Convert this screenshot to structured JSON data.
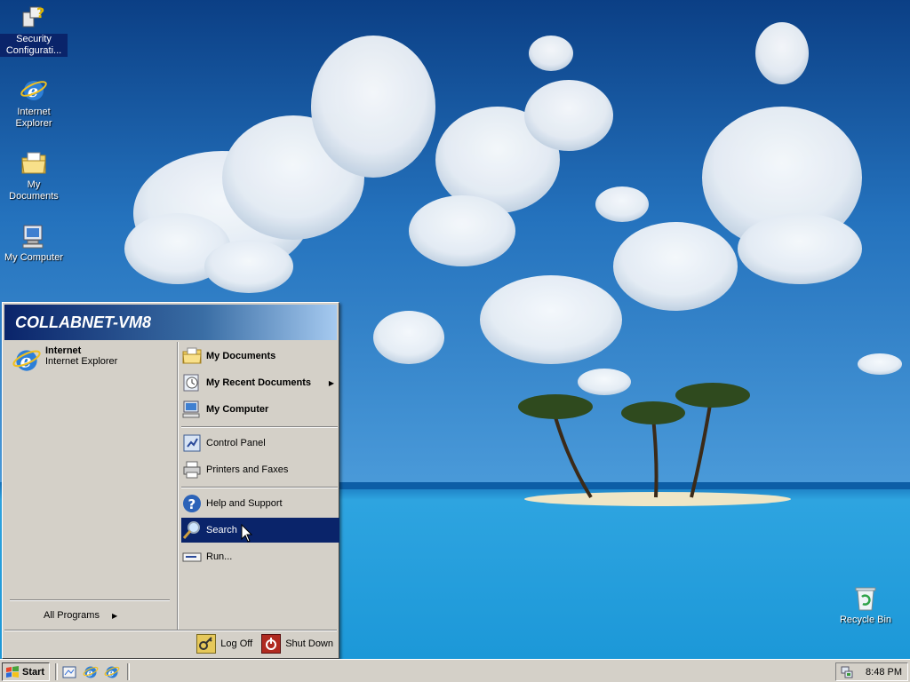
{
  "desktop": {
    "icons": [
      {
        "label": "Security Configurati...",
        "icon": "security-config-icon"
      },
      {
        "label": "Internet Explorer",
        "icon": "internet-explorer-icon"
      },
      {
        "label": "My Documents",
        "icon": "my-documents-icon"
      },
      {
        "label": "My Computer",
        "icon": "my-computer-icon"
      },
      {
        "label": "Recycle Bin",
        "icon": "recycle-bin-icon"
      }
    ]
  },
  "start_menu": {
    "header": "COLLABNET-VM8",
    "pinned": {
      "title": "Internet",
      "subtitle": "Internet Explorer",
      "icon": "internet-explorer-icon"
    },
    "all_programs": "All Programs",
    "right": [
      {
        "label": "My Documents",
        "icon": "my-documents-icon"
      },
      {
        "label": "My Recent Documents",
        "icon": "recent-documents-icon"
      },
      {
        "label": "My Computer",
        "icon": "my-computer-icon"
      },
      {
        "label": "Control Panel",
        "icon": "control-panel-icon"
      },
      {
        "label": "Printers and Faxes",
        "icon": "printer-icon"
      },
      {
        "label": "Help and Support",
        "icon": "help-icon"
      },
      {
        "label": "Search",
        "icon": "search-icon",
        "highlighted": true
      },
      {
        "label": "Run...",
        "icon": "run-icon"
      }
    ],
    "footer": {
      "log_off": "Log Off",
      "shut_down": "Shut Down"
    }
  },
  "taskbar": {
    "start_label": "Start",
    "clock": "8:48 PM"
  },
  "colors": {
    "highlight": "#0a246a",
    "face": "#d4d0c8"
  }
}
